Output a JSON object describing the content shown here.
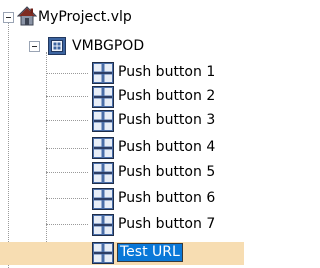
{
  "tree": {
    "root": {
      "label": "MyProject.vlp",
      "icon": "house-icon",
      "expanded": true
    },
    "page": {
      "label": "VMBGPOD",
      "icon": "module-icon",
      "expanded": true
    },
    "items": [
      {
        "label": "Push button 1",
        "icon": "push-button-icon"
      },
      {
        "label": "Push button 2",
        "icon": "push-button-icon"
      },
      {
        "label": "Push button 3",
        "icon": "push-button-icon"
      },
      {
        "label": "Push button 4",
        "icon": "push-button-icon"
      },
      {
        "label": "Push button 5",
        "icon": "push-button-icon"
      },
      {
        "label": "Push button 6",
        "icon": "push-button-icon"
      },
      {
        "label": "Push button 7",
        "icon": "push-button-icon"
      },
      {
        "label": "Test URL",
        "icon": "push-button-icon",
        "selected": true,
        "editing": true
      }
    ]
  },
  "colors": {
    "selection_row": "#f7ddb2",
    "edit_highlight": "#0a78d8",
    "connector": "#9a9a9a"
  }
}
